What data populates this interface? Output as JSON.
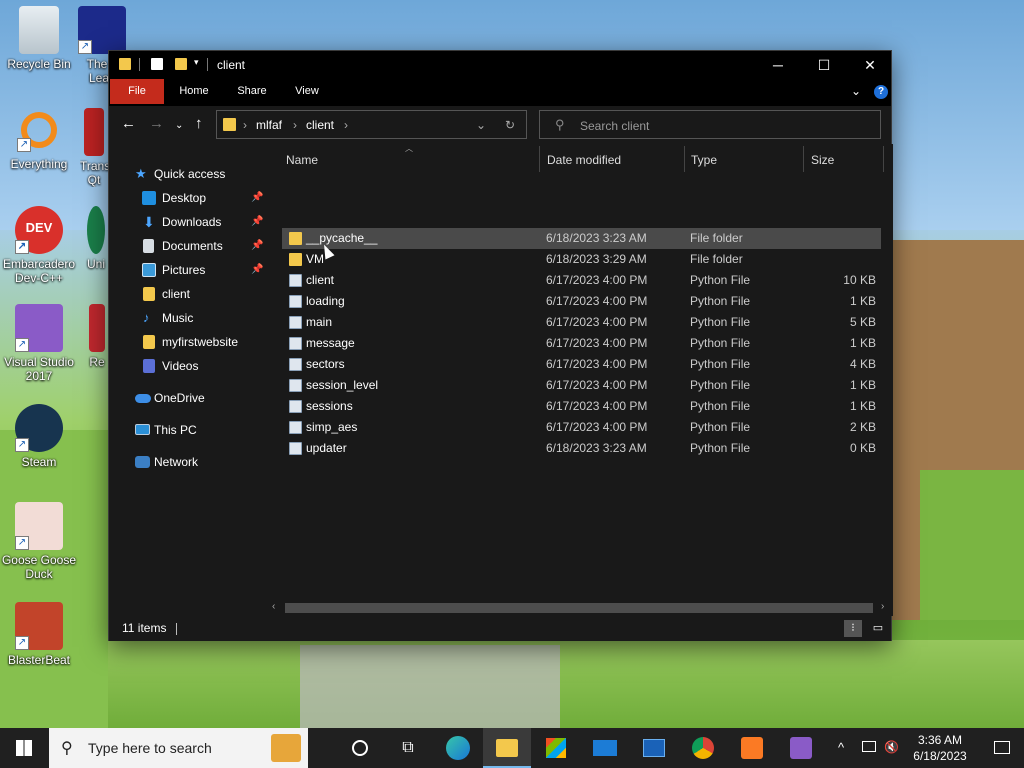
{
  "desktop": {
    "icons": [
      {
        "label": "Recycle Bin"
      },
      {
        "label": "The L Leak"
      },
      {
        "label": "Everything"
      },
      {
        "label": "Trans Qt"
      },
      {
        "label": "Embarcadero Dev-C++"
      },
      {
        "label": "Uni"
      },
      {
        "label": "Visual Studio 2017"
      },
      {
        "label": "Re"
      },
      {
        "label": "Steam"
      },
      {
        "label": "Goose Goose Duck"
      },
      {
        "label": "BlasterBeat"
      }
    ]
  },
  "window": {
    "title": "client",
    "ribbon_tabs": [
      "File",
      "Home",
      "Share",
      "View"
    ],
    "breadcrumb": [
      "mlfaf",
      "client"
    ],
    "search_placeholder": "Search client",
    "columns": {
      "name": "Name",
      "date": "Date modified",
      "type": "Type",
      "size": "Size"
    },
    "sidebar": [
      {
        "label": "Quick access",
        "icon": "star-icon"
      },
      {
        "label": "Desktop",
        "icon": "desktop-icon",
        "pinned": true
      },
      {
        "label": "Downloads",
        "icon": "download-icon",
        "pinned": true
      },
      {
        "label": "Documents",
        "icon": "document-icon",
        "pinned": true
      },
      {
        "label": "Pictures",
        "icon": "pictures-icon",
        "pinned": true
      },
      {
        "label": "client",
        "icon": "folder-icon"
      },
      {
        "label": "Music",
        "icon": "music-icon"
      },
      {
        "label": "myfirstwebsite",
        "icon": "folder-icon"
      },
      {
        "label": "Videos",
        "icon": "videos-icon"
      },
      {
        "label": "OneDrive",
        "icon": "cloud-icon"
      },
      {
        "label": "This PC",
        "icon": "computer-icon"
      },
      {
        "label": "Network",
        "icon": "network-icon"
      }
    ],
    "files": [
      {
        "name": "__pycache__",
        "date": "6/18/2023 3:23 AM",
        "type": "File folder",
        "size": ""
      },
      {
        "name": "VM",
        "date": "6/18/2023 3:29 AM",
        "type": "File folder",
        "size": ""
      },
      {
        "name": "client",
        "date": "6/17/2023 4:00 PM",
        "type": "Python File",
        "size": "10 KB"
      },
      {
        "name": "loading",
        "date": "6/17/2023 4:00 PM",
        "type": "Python File",
        "size": "1 KB"
      },
      {
        "name": "main",
        "date": "6/17/2023 4:00 PM",
        "type": "Python File",
        "size": "5 KB"
      },
      {
        "name": "message",
        "date": "6/17/2023 4:00 PM",
        "type": "Python File",
        "size": "1 KB"
      },
      {
        "name": "sectors",
        "date": "6/17/2023 4:00 PM",
        "type": "Python File",
        "size": "4 KB"
      },
      {
        "name": "session_level",
        "date": "6/17/2023 4:00 PM",
        "type": "Python File",
        "size": "1 KB"
      },
      {
        "name": "sessions",
        "date": "6/17/2023 4:00 PM",
        "type": "Python File",
        "size": "1 KB"
      },
      {
        "name": "simp_aes",
        "date": "6/17/2023 4:00 PM",
        "type": "Python File",
        "size": "2 KB"
      },
      {
        "name": "updater",
        "date": "6/18/2023 3:23 AM",
        "type": "Python File",
        "size": "0 KB"
      }
    ],
    "status": "11 items"
  },
  "taskbar": {
    "search_placeholder": "Type here to search",
    "time": "3:36 AM",
    "date": "6/18/2023"
  },
  "colors": {
    "accent_file_tab": "#c42b1c",
    "folder": "#f3c84c",
    "selection": "#4a4a4a"
  }
}
